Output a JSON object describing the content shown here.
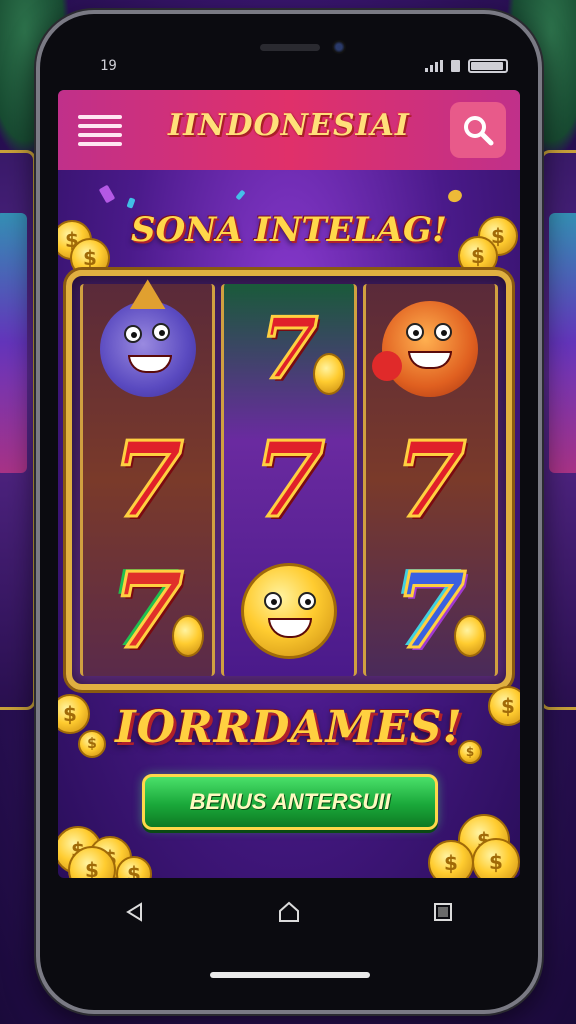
{
  "status_bar": {
    "time": "19",
    "signal_icon": "signal-bars-icon",
    "sim_icon": "sim-card-icon",
    "battery_icon": "battery-icon",
    "battery_level": 0.95
  },
  "header": {
    "title": "IINDONESIAI",
    "menu_icon": "hamburger-menu-icon",
    "search_icon": "search-icon"
  },
  "promo_title": "SONA INTELAG!",
  "slot": {
    "reels": [
      [
        "character-blue-jester",
        "seven-red",
        "seven-green-red"
      ],
      [
        "seven-red-coin",
        "seven-red",
        "character-gold-face"
      ],
      [
        "character-orange-boxer",
        "seven-red",
        "seven-blue-coin"
      ]
    ]
  },
  "jackpot_text": "IORRDAMES!",
  "bonus_button_label": "BENUS ANTERSUII",
  "nav": {
    "back_icon": "back-triangle-icon",
    "home_icon": "home-icon",
    "recents_icon": "recents-square-icon"
  },
  "colors": {
    "accent": "#e0306a",
    "gold": "#ffd040",
    "button_green": "#1aa83a",
    "background_purple": "#4a1a8a"
  }
}
